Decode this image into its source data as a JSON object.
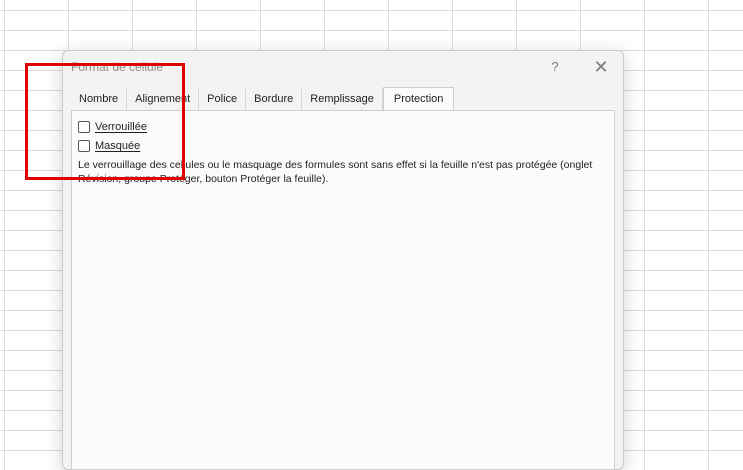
{
  "dialog": {
    "title": "Format de cellule",
    "help_label": "?",
    "close_label": "✕"
  },
  "tabs": [
    {
      "label": "Nombre"
    },
    {
      "label": "Alignement"
    },
    {
      "label": "Police"
    },
    {
      "label": "Bordure"
    },
    {
      "label": "Remplissage"
    },
    {
      "label": "Protection"
    }
  ],
  "protection": {
    "locked": {
      "label": "Verrouillée",
      "checked": false
    },
    "hidden": {
      "label": "Masquée",
      "checked": false
    },
    "description": "Le verrouillage des cellules ou le masquage des formules sont sans effet si la feuille n'est pas protégée (onglet Révision, groupe Protéger, bouton Protéger la feuille)."
  },
  "annotation": {
    "color": "#e00000"
  }
}
